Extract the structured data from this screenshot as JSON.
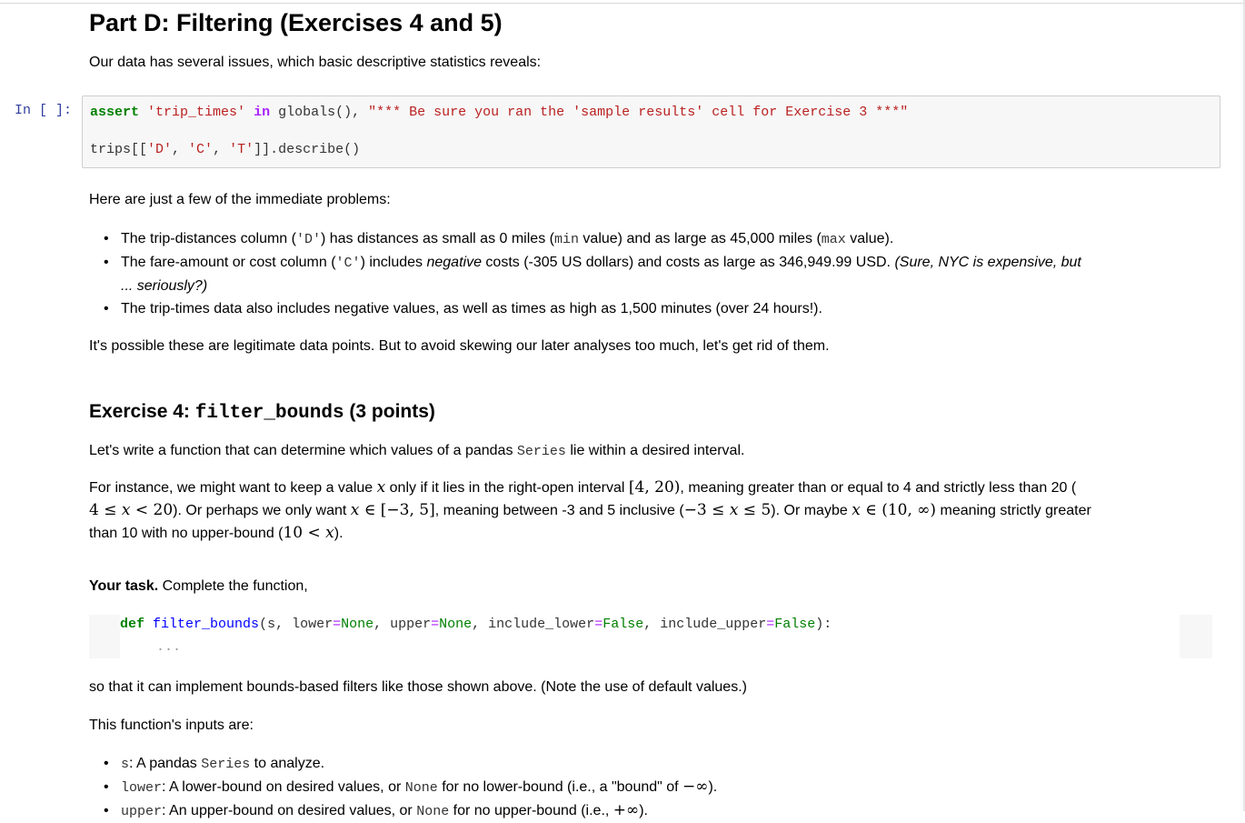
{
  "part_title": "Part D: Filtering (Exercises 4 and 5)",
  "intro": "Our data has several issues, which basic descriptive statistics reveals:",
  "cell": {
    "prompt": "In [ ]:",
    "line1": {
      "kw_assert": "assert",
      "s1": "'trip_times'",
      "kw_in": "in",
      "call": "globals(),",
      "s2": "\"*** Be sure you ran the 'sample results' cell for Exercise 3 ***\""
    },
    "line2_prefix": "trips[[",
    "line2_d": "'D'",
    "line2_sep1": ", ",
    "line2_c": "'C'",
    "line2_sep2": ", ",
    "line2_t": "'T'",
    "line2_suffix": "]].describe()"
  },
  "problems_intro": "Here are just a few of the immediate problems:",
  "problems": [
    {
      "t1": "The trip-distances column (",
      "code": "'D'",
      "t2": ") has distances as small as 0 miles (",
      "c2": "min",
      "t3": " value) and as large as 45,000 miles (",
      "c3": "max",
      "t4": " value)."
    },
    {
      "t1": "The fare-amount or cost column (",
      "code": "'C'",
      "t2": ") includes ",
      "em1": "negative",
      "t3": " costs (-305 US dollars) and costs as large as 346,949.99 USD. ",
      "em2": "(Sure, NYC is expensive, but",
      "em3": "... seriously?)"
    },
    {
      "t1": "The trip-times data also includes negative values, as well as times as high as 1,500 minutes (over 24 hours!)."
    }
  ],
  "closing": "It's possible these are legitimate data points. But to avoid skewing our later analyses too much, let's get rid of them.",
  "exercise": {
    "title_pre": "Exercise 4: ",
    "title_code": "filter_bounds",
    "title_post": " (3 points)"
  },
  "task_intro_pre": "Let's write a function that can determine which values of a pandas ",
  "task_intro_code": "Series",
  "task_intro_post": " lie within a desired interval.",
  "instance": {
    "a1": "For instance, we might want to keep a value ",
    "x": "x",
    "a2": " only if it lies in the right-open interval ",
    "int1": "[4, 20)",
    "a3": ", meaning greater than or equal to 4 and strictly less than 20 (",
    "b1": "4 ≤ ",
    "b2": " < 20",
    "b3": "). Or perhaps we only want ",
    "b4": " ∈ ",
    "int2": "[−3, 5]",
    "b5": ", meaning between -3 and 5 inclusive (",
    "b6": "−3 ≤ ",
    "b7": " ≤ 5",
    "b8": "). Or maybe ",
    "b9": " ∈ ",
    "int3": "(10, ∞)",
    "b10": " meaning strictly greater",
    "c1": "than 10 with no upper-bound (",
    "c2": "10 < ",
    "c3": ")."
  },
  "your_task_bold": "Your task.",
  "your_task_rest": " Complete the function,",
  "signature": {
    "def": "def",
    "name": "filter_bounds",
    "p1": "(s, lower",
    "eq": "=",
    "none1": "None",
    "p2": ", upper",
    "none2": "None",
    "p3": ", include_lower",
    "false1": "False",
    "p4": ", include_upper",
    "false2": "False",
    "p5": "):",
    "body": "..."
  },
  "after_sig": "so that it can implement bounds-based filters like those shown above. (Note the use of default values.)",
  "inputs_intro": "This function's inputs are:",
  "inputs": [
    {
      "code": "s",
      "text": ": A pandas ",
      "code2": "Series",
      "text2": " to analyze."
    },
    {
      "code": "lower",
      "text": ": A lower-bound on desired values, or ",
      "code2": "None",
      "text2": " for no lower-bound (i.e., a \"bound\" of ",
      "math": "−∞",
      "text3": ")."
    },
    {
      "code": "upper",
      "text": ": An upper-bound on desired values, or ",
      "code2": "None",
      "text2": " for no upper-bound (i.e., ",
      "math": "+∞",
      "text3": ")."
    }
  ]
}
